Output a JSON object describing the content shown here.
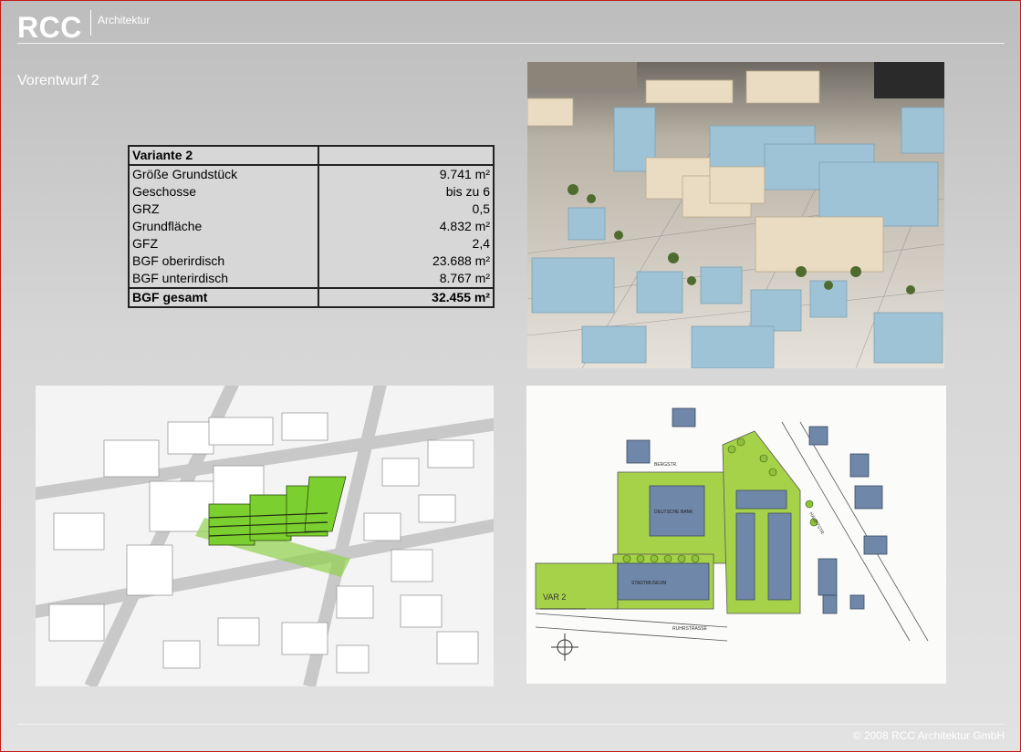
{
  "header": {
    "logo": "RCC",
    "subtitle": "Architektur"
  },
  "page": {
    "title": "Vorentwurf 2"
  },
  "table": {
    "heading": "Variante 2",
    "rows": [
      {
        "label": "Größe Grundstück",
        "value": "9.741 m²"
      },
      {
        "label": "Geschosse",
        "value": "bis zu 6"
      },
      {
        "label": "GRZ",
        "value": "0,5"
      },
      {
        "label": "Grundfläche",
        "value": "4.832 m²"
      },
      {
        "label": "GFZ",
        "value": "2,4"
      },
      {
        "label": "BGF oberirdisch",
        "value": "23.688 m²"
      },
      {
        "label": "BGF unterirdisch",
        "value": "8.767 m²"
      }
    ],
    "total": {
      "label": "BGF gesamt",
      "value": "32.455 m²"
    }
  },
  "plan": {
    "label_var": "VAR 2",
    "label_bank": "DEUTSCHE BANK",
    "label_museum": "STADTMUSEUM",
    "label_street1": "RUHRSTRASSE",
    "label_street2": "BERGSTR.",
    "label_street3": "HAUPTSTR."
  },
  "colors": {
    "accent_border": "#c21a1a",
    "plan_green": "#a6d24a",
    "plan_blue": "#6f87a8",
    "model_blue": "#9fc3d6"
  },
  "footer": {
    "copyright": "© 2008 RCC Architektur GmbH"
  }
}
